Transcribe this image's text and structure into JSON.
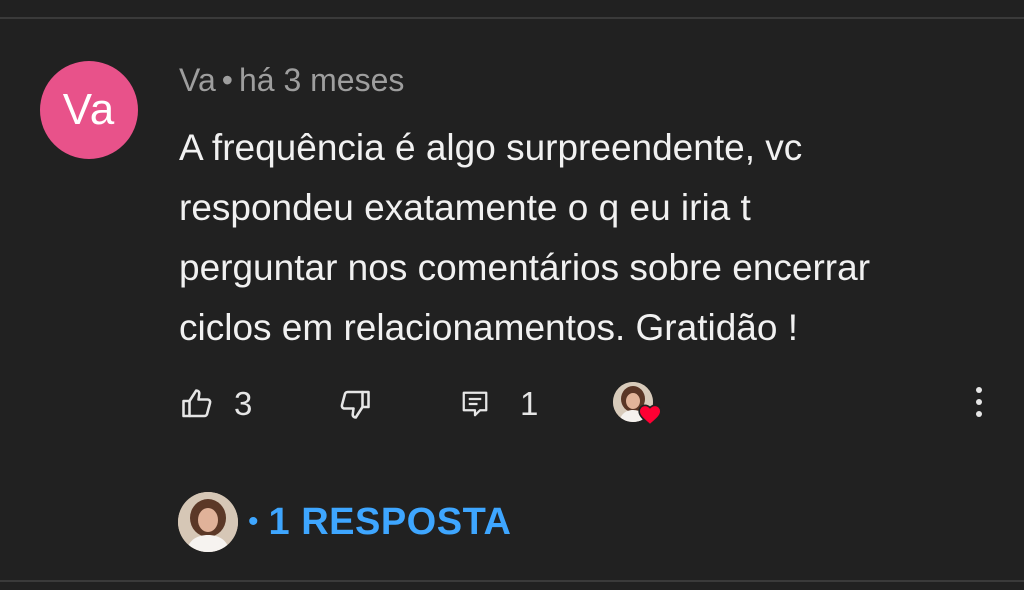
{
  "comment": {
    "avatar_initials": "Va",
    "avatar_color": "#e8528a",
    "author": "Va",
    "separator": "•",
    "time": "há 3 meses",
    "text_lines": [
      "A frequência é algo surpreendente, vc",
      "respondeu exatamente o q eu iria t",
      "perguntar nos comentários sobre encerrar",
      "ciclos em relacionamentos. Gratidão !"
    ]
  },
  "actions": {
    "like_icon": "thumbs-up-icon",
    "like_count": "3",
    "dislike_icon": "thumbs-down-icon",
    "reply_icon": "comment-icon",
    "reply_count": "1",
    "creator_heart_icon": "heart-icon",
    "more_icon": "more-vertical-icon"
  },
  "replies": {
    "dot": "•",
    "label": "1 RESPOSTA",
    "color": "#3ea6ff"
  },
  "colors": {
    "background": "#212121",
    "heart": "#ff0033"
  }
}
